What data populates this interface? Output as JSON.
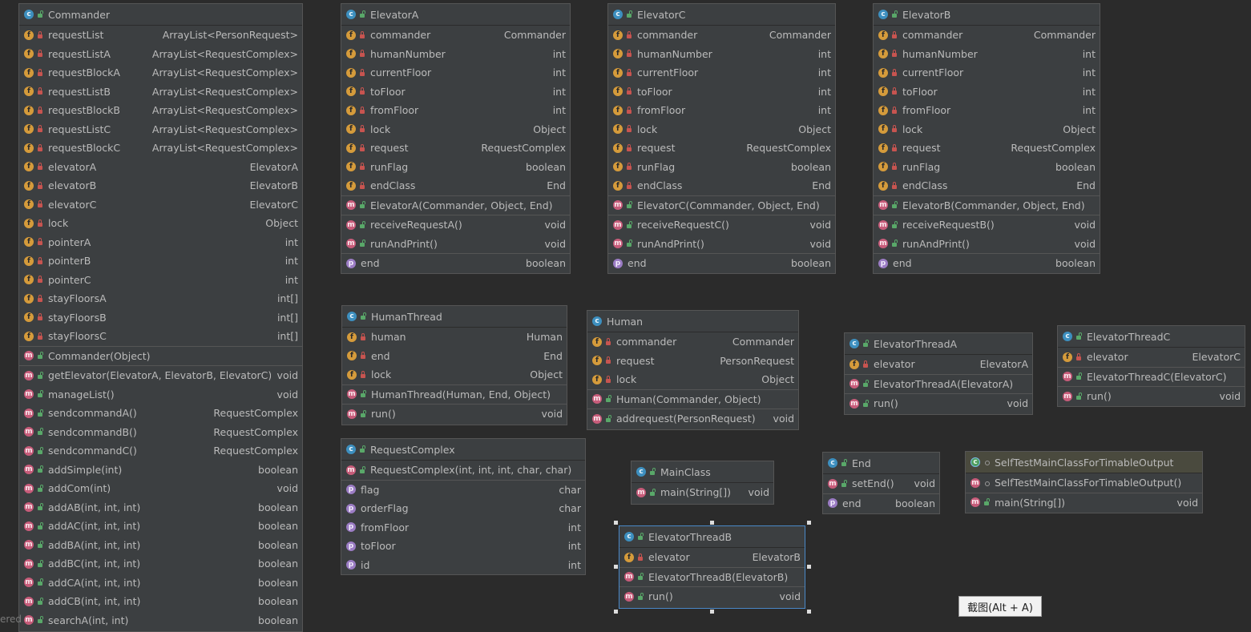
{
  "classes": {
    "commander": {
      "title": "Commander",
      "fields": [
        {
          "name": "requestList",
          "type": "ArrayList<PersonRequest>"
        },
        {
          "name": "requestListA",
          "type": "ArrayList<RequestComplex>"
        },
        {
          "name": "requestBlockA",
          "type": "ArrayList<RequestComplex>"
        },
        {
          "name": "requestListB",
          "type": "ArrayList<RequestComplex>"
        },
        {
          "name": "requestBlockB",
          "type": "ArrayList<RequestComplex>"
        },
        {
          "name": "requestListC",
          "type": "ArrayList<RequestComplex>"
        },
        {
          "name": "requestBlockC",
          "type": "ArrayList<RequestComplex>"
        },
        {
          "name": "elevatorA",
          "type": "ElevatorA"
        },
        {
          "name": "elevatorB",
          "type": "ElevatorB"
        },
        {
          "name": "elevatorC",
          "type": "ElevatorC"
        },
        {
          "name": "lock",
          "type": "Object"
        },
        {
          "name": "pointerA",
          "type": "int"
        },
        {
          "name": "pointerB",
          "type": "int"
        },
        {
          "name": "pointerC",
          "type": "int"
        },
        {
          "name": "stayFloorsA",
          "type": "int[]"
        },
        {
          "name": "stayFloorsB",
          "type": "int[]"
        },
        {
          "name": "stayFloorsC",
          "type": "int[]"
        }
      ],
      "constructors": [
        {
          "name": "Commander(Object)",
          "type": ""
        }
      ],
      "methods": [
        {
          "name": "getElevator(ElevatorA, ElevatorB, ElevatorC)",
          "type": "void"
        },
        {
          "name": "manageList()",
          "type": "void"
        },
        {
          "name": "sendcommandA()",
          "type": "RequestComplex"
        },
        {
          "name": "sendcommandB()",
          "type": "RequestComplex"
        },
        {
          "name": "sendcommandC()",
          "type": "RequestComplex"
        },
        {
          "name": "addSimple(int)",
          "type": "boolean"
        },
        {
          "name": "addCom(int)",
          "type": "void"
        },
        {
          "name": "addAB(int, int, int)",
          "type": "boolean"
        },
        {
          "name": "addAC(int, int, int)",
          "type": "boolean"
        },
        {
          "name": "addBA(int, int, int)",
          "type": "boolean"
        },
        {
          "name": "addBC(int, int, int)",
          "type": "boolean"
        },
        {
          "name": "addCA(int, int, int)",
          "type": "boolean"
        },
        {
          "name": "addCB(int, int, int)",
          "type": "boolean"
        },
        {
          "name": "searchA(int, int)",
          "type": "boolean"
        }
      ]
    },
    "elevatorA": {
      "title": "ElevatorA",
      "fields": [
        {
          "name": "commander",
          "type": "Commander"
        },
        {
          "name": "humanNumber",
          "type": "int"
        },
        {
          "name": "currentFloor",
          "type": "int"
        },
        {
          "name": "toFloor",
          "type": "int"
        },
        {
          "name": "fromFloor",
          "type": "int"
        },
        {
          "name": "lock",
          "type": "Object"
        },
        {
          "name": "request",
          "type": "RequestComplex"
        },
        {
          "name": "runFlag",
          "type": "boolean"
        },
        {
          "name": "endClass",
          "type": "End"
        }
      ],
      "constructors": [
        {
          "name": "ElevatorA(Commander, Object, End)",
          "type": ""
        }
      ],
      "methods": [
        {
          "name": "receiveRequestA()",
          "type": "void"
        },
        {
          "name": "runAndPrint()",
          "type": "void"
        }
      ],
      "properties": [
        {
          "name": "end",
          "type": "boolean"
        }
      ]
    },
    "elevatorC": {
      "title": "ElevatorC",
      "fields": [
        {
          "name": "commander",
          "type": "Commander"
        },
        {
          "name": "humanNumber",
          "type": "int"
        },
        {
          "name": "currentFloor",
          "type": "int"
        },
        {
          "name": "toFloor",
          "type": "int"
        },
        {
          "name": "fromFloor",
          "type": "int"
        },
        {
          "name": "lock",
          "type": "Object"
        },
        {
          "name": "request",
          "type": "RequestComplex"
        },
        {
          "name": "runFlag",
          "type": "boolean"
        },
        {
          "name": "endClass",
          "type": "End"
        }
      ],
      "constructors": [
        {
          "name": "ElevatorC(Commander, Object, End)",
          "type": ""
        }
      ],
      "methods": [
        {
          "name": "receiveRequestC()",
          "type": "void"
        },
        {
          "name": "runAndPrint()",
          "type": "void"
        }
      ],
      "properties": [
        {
          "name": "end",
          "type": "boolean"
        }
      ]
    },
    "elevatorB": {
      "title": "ElevatorB",
      "fields": [
        {
          "name": "commander",
          "type": "Commander"
        },
        {
          "name": "humanNumber",
          "type": "int"
        },
        {
          "name": "currentFloor",
          "type": "int"
        },
        {
          "name": "toFloor",
          "type": "int"
        },
        {
          "name": "fromFloor",
          "type": "int"
        },
        {
          "name": "lock",
          "type": "Object"
        },
        {
          "name": "request",
          "type": "RequestComplex"
        },
        {
          "name": "runFlag",
          "type": "boolean"
        },
        {
          "name": "endClass",
          "type": "End"
        }
      ],
      "constructors": [
        {
          "name": "ElevatorB(Commander, Object, End)",
          "type": ""
        }
      ],
      "methods": [
        {
          "name": "receiveRequestB()",
          "type": "void"
        },
        {
          "name": "runAndPrint()",
          "type": "void"
        }
      ],
      "properties": [
        {
          "name": "end",
          "type": "boolean"
        }
      ]
    },
    "humanThread": {
      "title": "HumanThread",
      "fields": [
        {
          "name": "human",
          "type": "Human"
        },
        {
          "name": "end",
          "type": "End"
        },
        {
          "name": "lock",
          "type": "Object"
        }
      ],
      "constructors": [
        {
          "name": "HumanThread(Human, End, Object)",
          "type": ""
        }
      ],
      "methods": [
        {
          "name": "run()",
          "type": "void"
        }
      ]
    },
    "human": {
      "title": "Human",
      "fields": [
        {
          "name": "commander",
          "type": "Commander"
        },
        {
          "name": "request",
          "type": "PersonRequest"
        },
        {
          "name": "lock",
          "type": "Object"
        }
      ],
      "constructors": [
        {
          "name": "Human(Commander, Object)",
          "type": ""
        }
      ],
      "methods": [
        {
          "name": "addrequest(PersonRequest)",
          "type": "void"
        }
      ]
    },
    "elevatorThreadA": {
      "title": "ElevatorThreadA",
      "fields": [
        {
          "name": "elevator",
          "type": "ElevatorA"
        }
      ],
      "constructors": [
        {
          "name": "ElevatorThreadA(ElevatorA)",
          "type": ""
        }
      ],
      "methods": [
        {
          "name": "run()",
          "type": "void"
        }
      ]
    },
    "elevatorThreadC": {
      "title": "ElevatorThreadC",
      "fields": [
        {
          "name": "elevator",
          "type": "ElevatorC"
        }
      ],
      "constructors": [
        {
          "name": "ElevatorThreadC(ElevatorC)",
          "type": ""
        }
      ],
      "methods": [
        {
          "name": "run()",
          "type": "void"
        }
      ]
    },
    "requestComplex": {
      "title": "RequestComplex",
      "constructors": [
        {
          "name": "RequestComplex(int, int, int, char, char)",
          "type": ""
        }
      ],
      "properties": [
        {
          "name": "flag",
          "type": "char"
        },
        {
          "name": "orderFlag",
          "type": "char"
        },
        {
          "name": "fromFloor",
          "type": "int"
        },
        {
          "name": "toFloor",
          "type": "int"
        },
        {
          "name": "id",
          "type": "int"
        }
      ]
    },
    "mainClass": {
      "title": "MainClass",
      "methods": [
        {
          "name": "main(String[])",
          "type": "void"
        }
      ]
    },
    "end": {
      "title": "End",
      "methods": [
        {
          "name": "setEnd()",
          "type": "void"
        }
      ],
      "properties": [
        {
          "name": "end",
          "type": "boolean"
        }
      ]
    },
    "selfTest": {
      "title": "SelfTestMainClassForTimableOutput",
      "constructors": [
        {
          "name": "SelfTestMainClassForTimableOutput()",
          "type": ""
        }
      ],
      "methods": [
        {
          "name": "main(String[])",
          "type": "void"
        }
      ]
    },
    "elevatorThreadB": {
      "title": "ElevatorThreadB",
      "fields": [
        {
          "name": "elevator",
          "type": "ElevatorB"
        }
      ],
      "constructors": [
        {
          "name": "ElevatorThreadB(ElevatorB)",
          "type": ""
        }
      ],
      "methods": [
        {
          "name": "run()",
          "type": "void"
        }
      ]
    }
  },
  "tooltip": "截图(Alt + A)",
  "left_cut_text": "ered"
}
